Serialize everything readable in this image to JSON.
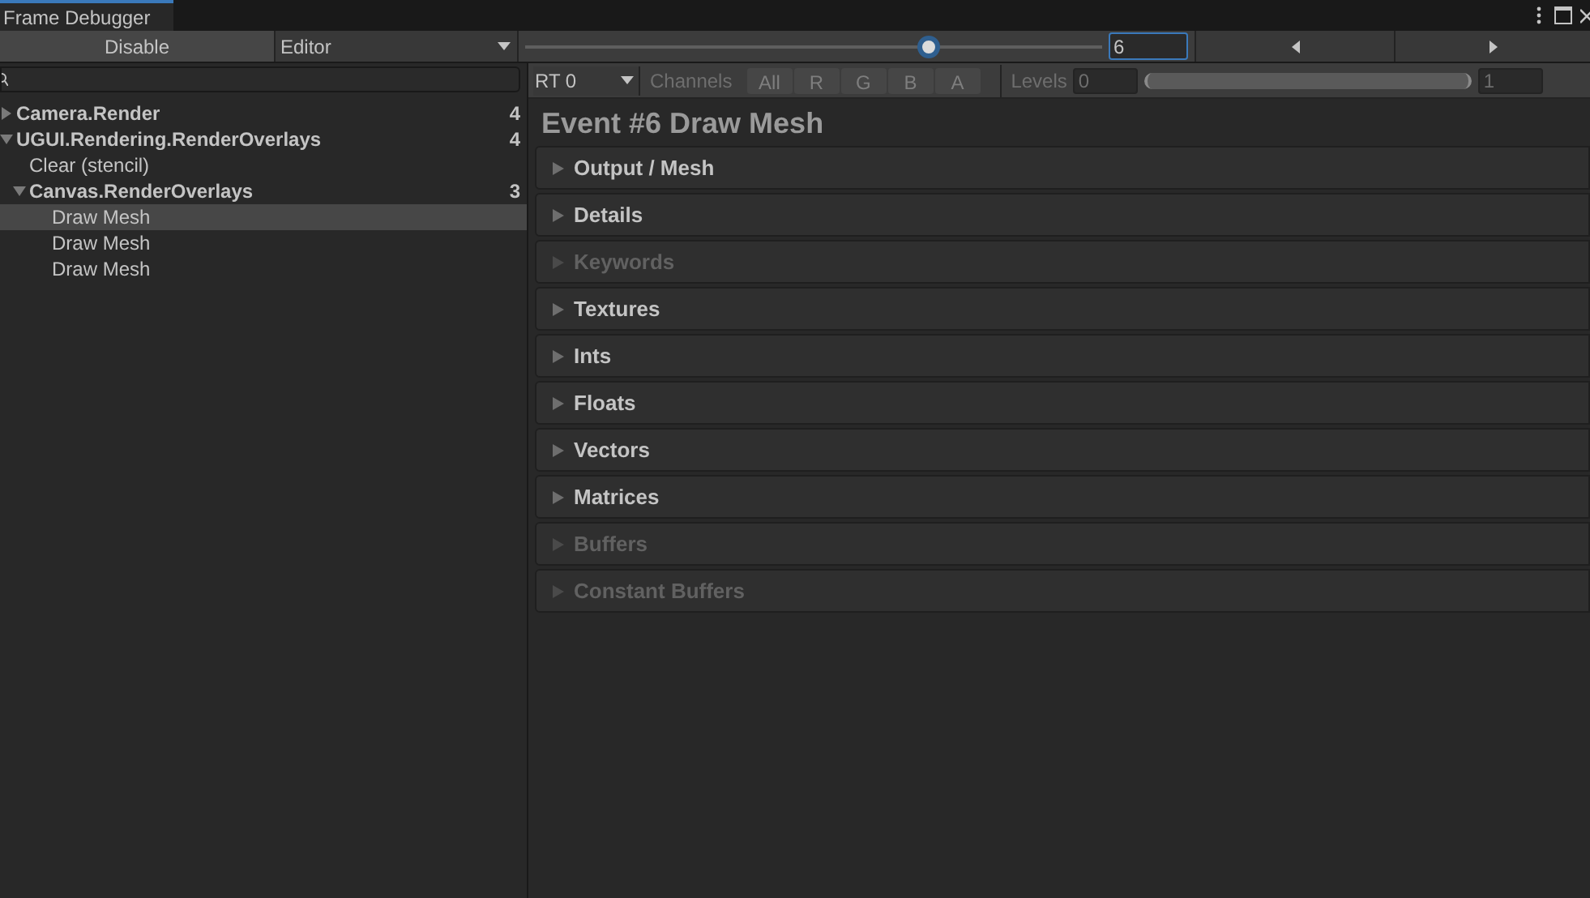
{
  "window": {
    "title": "Frame Debugger"
  },
  "toolbar": {
    "disable_button": "Disable",
    "target_dropdown": "Editor",
    "event_slider": {
      "level": 0.7
    },
    "event_field": "6"
  },
  "tree": [
    {
      "label": "Camera.Render",
      "count": "4",
      "bold": true,
      "expanded": false,
      "selected": false
    },
    {
      "label": "UGUI.Rendering.RenderOverlays",
      "count": "4",
      "bold": true,
      "expanded": true,
      "selected": false,
      "children": [
        {
          "label": "Clear (stencil)",
          "bold": false,
          "selected": false
        },
        {
          "label": "Canvas.RenderOverlays",
          "count": "3",
          "bold": true,
          "expanded": true,
          "selected": false,
          "children": [
            {
              "label": "Draw Mesh",
              "bold": false,
              "selected": true
            },
            {
              "label": "Draw Mesh",
              "bold": false,
              "selected": false
            },
            {
              "label": "Draw Mesh",
              "bold": false,
              "selected": false
            }
          ]
        }
      ]
    }
  ],
  "render_bar": {
    "target": "RT 0",
    "channels_label": "Channels",
    "channels": [
      "All",
      "R",
      "G",
      "B",
      "A"
    ],
    "levels_label": "Levels",
    "levels_min": "0",
    "levels_slider": {
      "level": 1
    },
    "levels_max": "1"
  },
  "event_title": "Event #6 Draw Mesh",
  "sections": [
    {
      "label": "Output / Mesh",
      "disabled": false
    },
    {
      "label": "Details",
      "disabled": false
    },
    {
      "label": "Keywords",
      "disabled": true
    },
    {
      "label": "Textures",
      "disabled": false
    },
    {
      "label": "Ints",
      "disabled": false
    },
    {
      "label": "Floats",
      "disabled": false
    },
    {
      "label": "Vectors",
      "disabled": false
    },
    {
      "label": "Matrices",
      "disabled": false
    },
    {
      "label": "Buffers",
      "disabled": true
    },
    {
      "label": "Constant Buffers",
      "disabled": true
    }
  ]
}
